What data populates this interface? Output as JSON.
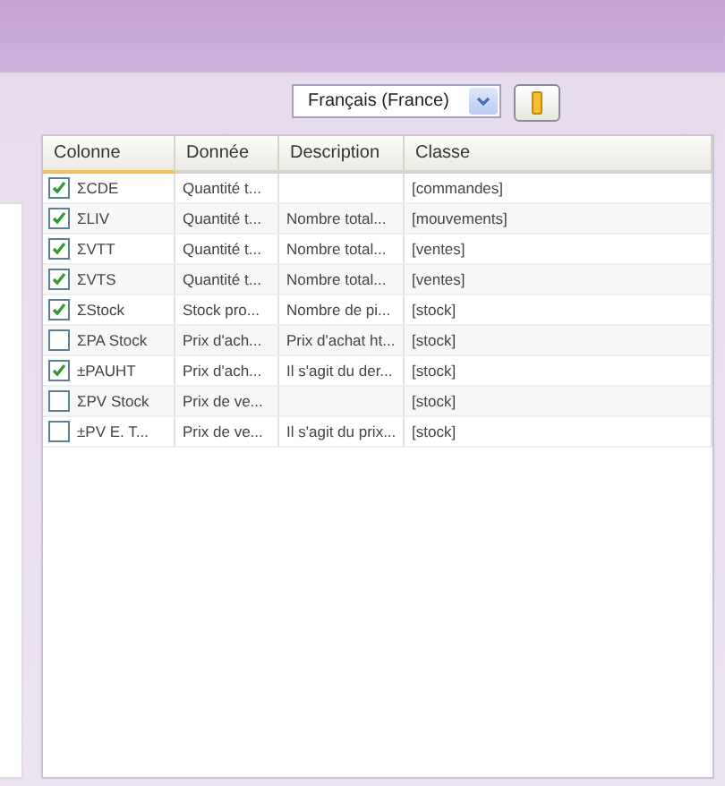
{
  "language_select": {
    "value": "Français (France)"
  },
  "table": {
    "columns": [
      "Colonne",
      "Donnée",
      "Description",
      "Classe"
    ],
    "rows": [
      {
        "checked": true,
        "cells": [
          "ΣCDE",
          "Quantité t...",
          "",
          "[commandes]"
        ]
      },
      {
        "checked": true,
        "cells": [
          "ΣLIV",
          "Quantité t...",
          "Nombre total...",
          "[mouvements]"
        ]
      },
      {
        "checked": true,
        "cells": [
          "ΣVTT",
          "Quantité t...",
          "Nombre total...",
          "[ventes]"
        ]
      },
      {
        "checked": true,
        "cells": [
          "ΣVTS",
          "Quantité t...",
          "Nombre total...",
          "[ventes]"
        ]
      },
      {
        "checked": true,
        "cells": [
          "ΣStock",
          "Stock pro...",
          "Nombre de pi...",
          "[stock]"
        ]
      },
      {
        "checked": false,
        "cells": [
          "ΣPA Stock",
          "Prix d'ach...",
          "Prix d'achat ht...",
          "[stock]"
        ]
      },
      {
        "checked": true,
        "cells": [
          "±PAUHT",
          "Prix d'ach...",
          "Il s'agit du der...",
          "[stock]"
        ]
      },
      {
        "checked": false,
        "cells": [
          "ΣPV Stock",
          "Prix de ve...",
          "",
          "[stock]"
        ]
      },
      {
        "checked": false,
        "cells": [
          "±PV E. T...",
          "Prix de ve...",
          "Il s'agit du prix...",
          "[stock]"
        ]
      }
    ]
  }
}
